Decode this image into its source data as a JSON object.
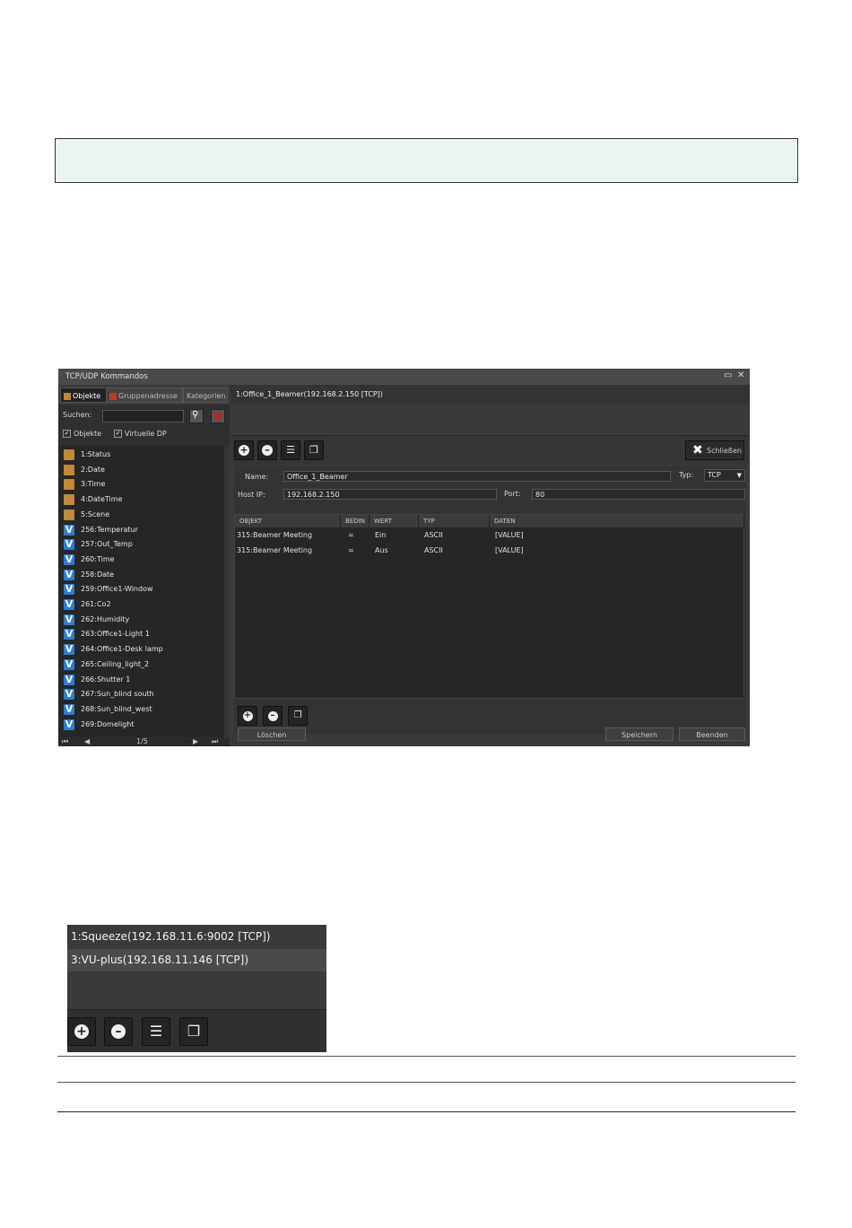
{
  "window": {
    "title": "TCP/UDP Kommandos",
    "restore_glyph": "▭",
    "close_glyph": "✕"
  },
  "left_panel": {
    "tabs": [
      "Objekte",
      "Gruppenadresse",
      "Kategorien"
    ],
    "search_label": "Suchen:",
    "search_value": "",
    "checks": [
      {
        "label": "Objekte",
        "checked": true
      },
      {
        "label": "Virtuelle DP",
        "checked": true
      }
    ],
    "items": [
      {
        "label": "1:Status",
        "icon": "box-icon"
      },
      {
        "label": "2:Date",
        "icon": "box-icon"
      },
      {
        "label": "3:Time",
        "icon": "box-icon"
      },
      {
        "label": "4:DateTime",
        "icon": "box-icon"
      },
      {
        "label": "5:Scene",
        "icon": "box-icon"
      },
      {
        "label": "256:Temperatur",
        "icon": "v-icon"
      },
      {
        "label": "257:Out_Temp",
        "icon": "v-icon"
      },
      {
        "label": "260:Time",
        "icon": "v-icon"
      },
      {
        "label": "258:Date",
        "icon": "v-icon"
      },
      {
        "label": "259:Office1-Window",
        "icon": "v-icon"
      },
      {
        "label": "261:Co2",
        "icon": "v-icon"
      },
      {
        "label": "262:Humidity",
        "icon": "v-icon"
      },
      {
        "label": "263:Office1-Light 1",
        "icon": "v-icon"
      },
      {
        "label": "264:Office1-Desk lamp",
        "icon": "v-icon"
      },
      {
        "label": "265:Ceiling_light_2",
        "icon": "v-icon"
      },
      {
        "label": "266:Shutter 1",
        "icon": "v-icon"
      },
      {
        "label": "267:Sun_blind south",
        "icon": "v-icon"
      },
      {
        "label": "268:Sun_blind_west",
        "icon": "v-icon"
      },
      {
        "label": "269:Domelight",
        "icon": "v-icon"
      }
    ],
    "pager": "1/5"
  },
  "right_panel": {
    "selected_command": "1:Office_1_Beamer(192.168.2.150 [TCP])",
    "close_label": "Schließen",
    "form": {
      "name_label": "Name:",
      "name_value": "Office_1_Beamer",
      "type_label": "Typ:",
      "type_value": "TCP",
      "host_label": "Host IP:",
      "host_value": "192.168.2.150",
      "port_label": "Port:",
      "port_value": "80"
    },
    "grid": {
      "columns": [
        "OBJEKT",
        "BEDIN",
        "WERT",
        "TYP",
        "DATEN"
      ],
      "rows": [
        {
          "objekt": "315:Beamer Meeting",
          "bedin": "=",
          "wert": "Ein",
          "typ": "ASCII",
          "daten": "[VALUE]"
        },
        {
          "objekt": "315:Beamer Meeting",
          "bedin": "=",
          "wert": "Aus",
          "typ": "ASCII",
          "daten": "[VALUE]"
        }
      ]
    },
    "buttons": {
      "delete": "Löschen",
      "save": "Speichern",
      "finish": "Beenden"
    }
  },
  "snippet": {
    "items": [
      "1:Squeeze(192.168.11.6:9002 [TCP])",
      "3:VU-plus(192.168.11.146 [TCP])"
    ]
  }
}
